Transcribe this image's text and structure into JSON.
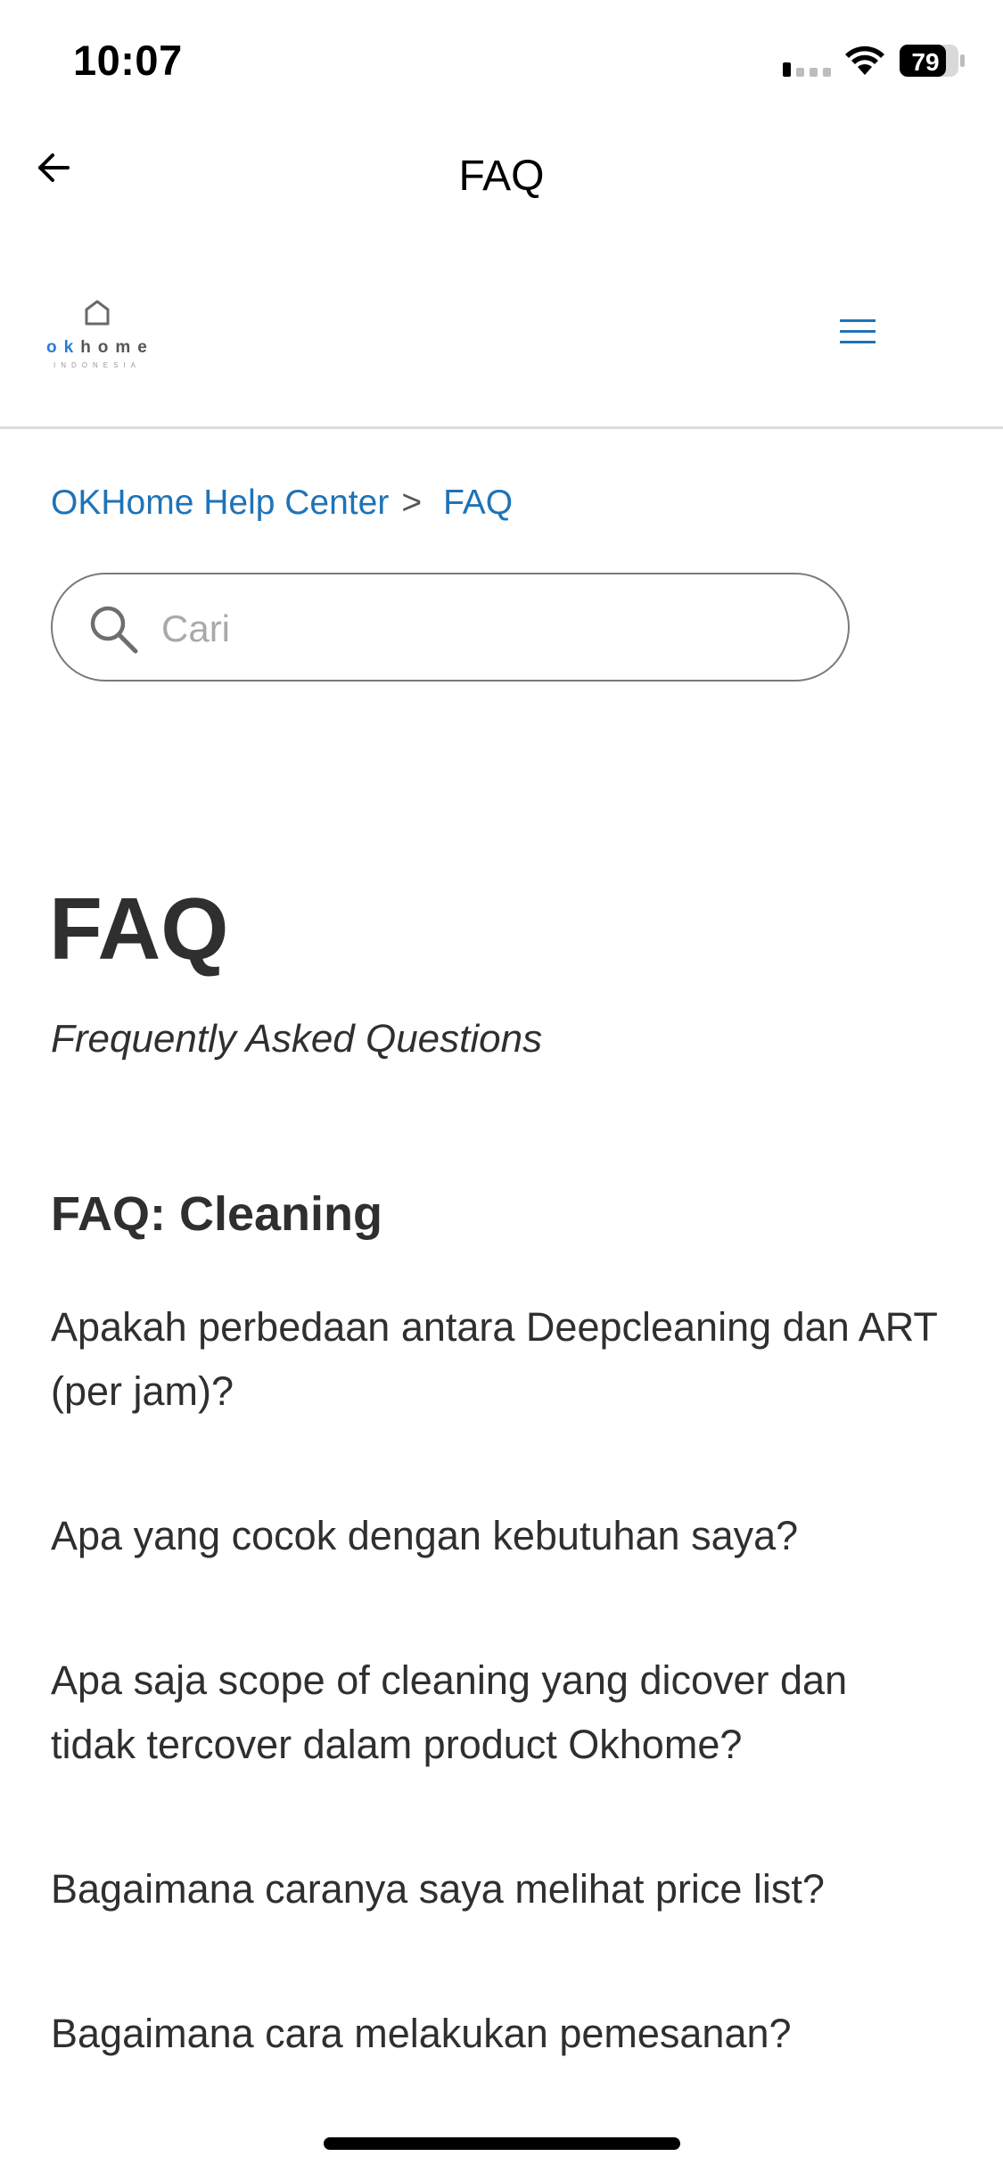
{
  "status_bar": {
    "time": "10:07",
    "battery_level": "79",
    "icons": [
      "signal-icon",
      "wifi-icon",
      "battery-icon"
    ]
  },
  "nav": {
    "title": "FAQ",
    "back_icon": "arrow-left-icon"
  },
  "header": {
    "logo_text_ok": "ok",
    "logo_text_rest": "home",
    "logo_subtext": "INDONESIA",
    "menu_icon": "hamburger-menu-icon",
    "accent_color": "#1f73b7"
  },
  "breadcrumb": {
    "home": "OKHome Help Center",
    "separator": ">",
    "current": "FAQ"
  },
  "search": {
    "placeholder": "Cari",
    "value": ""
  },
  "main": {
    "title": "FAQ",
    "subtitle": "Frequently Asked Questions",
    "section_heading": "FAQ: Cleaning",
    "faqs": [
      "Apakah perbedaan antara Deepcleaning dan ART (per jam)?",
      "Apa yang cocok dengan kebutuhan saya?",
      "Apa saja scope of cleaning yang dicover dan tidak tercover dalam product Okhome?",
      "Bagaimana caranya saya melihat price list?",
      "Bagaimana cara melakukan pemesanan?"
    ]
  }
}
